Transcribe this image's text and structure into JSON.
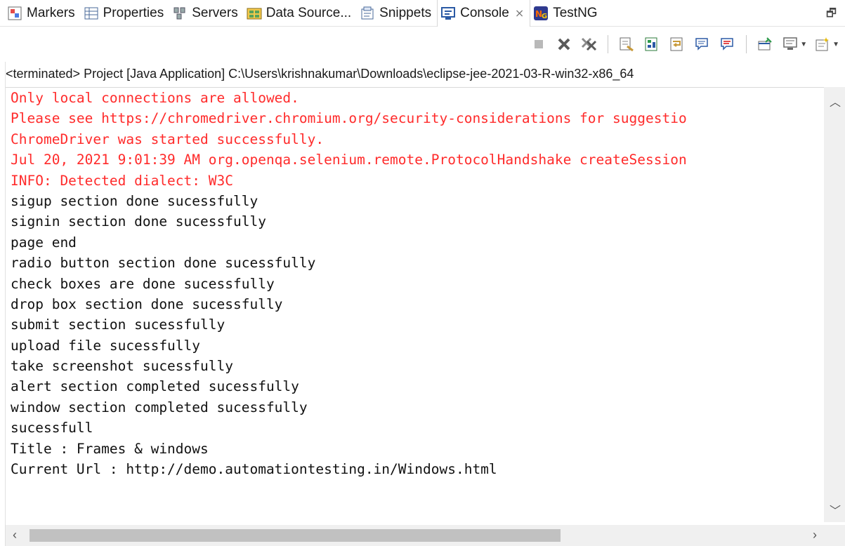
{
  "tabs": [
    {
      "label": "Markers",
      "icon": "markers-icon"
    },
    {
      "label": "Properties",
      "icon": "properties-icon"
    },
    {
      "label": "Servers",
      "icon": "servers-icon"
    },
    {
      "label": "Data Source...",
      "icon": "data-source-icon"
    },
    {
      "label": "Snippets",
      "icon": "snippets-icon"
    },
    {
      "label": "Console",
      "icon": "console-icon",
      "active": true,
      "close": "⨯"
    },
    {
      "label": "TestNG",
      "icon": "testng-icon"
    }
  ],
  "status_line": "<terminated> Project [Java Application] C:\\Users\\krishnakumar\\Downloads\\eclipse-jee-2021-03-R-win32-x86_64",
  "console_lines": [
    {
      "text": "Only local connections are allowed.",
      "kind": "err"
    },
    {
      "text": "Please see https://chromedriver.chromium.org/security-considerations for suggestio",
      "kind": "err"
    },
    {
      "text": "ChromeDriver was started successfully.",
      "kind": "err"
    },
    {
      "text": "Jul 20, 2021 9:01:39 AM org.openqa.selenium.remote.ProtocolHandshake createSession",
      "kind": "err"
    },
    {
      "text": "INFO: Detected dialect: W3C",
      "kind": "err"
    },
    {
      "text": "sigup section done sucessfully",
      "kind": "out"
    },
    {
      "text": "signin section done sucessfully",
      "kind": "out"
    },
    {
      "text": "page end",
      "kind": "out"
    },
    {
      "text": "radio button section done sucessfully",
      "kind": "out"
    },
    {
      "text": "check boxes are done sucessfully",
      "kind": "out"
    },
    {
      "text": "drop box section done sucessfully",
      "kind": "out"
    },
    {
      "text": "submit section sucessfully",
      "kind": "out"
    },
    {
      "text": "upload file sucessfully",
      "kind": "out"
    },
    {
      "text": "take screenshot sucessfully",
      "kind": "out"
    },
    {
      "text": "alert section completed sucessfully",
      "kind": "out"
    },
    {
      "text": "window section completed sucessfully",
      "kind": "out"
    },
    {
      "text": "sucessfull",
      "kind": "out"
    },
    {
      "text": "Title : Frames & windows",
      "kind": "out"
    },
    {
      "text": "Current Url : http://demo.automationtesting.in/Windows.html",
      "kind": "out"
    }
  ],
  "colors": {
    "stderr": "#ff2b2b",
    "stdout": "#111111"
  }
}
